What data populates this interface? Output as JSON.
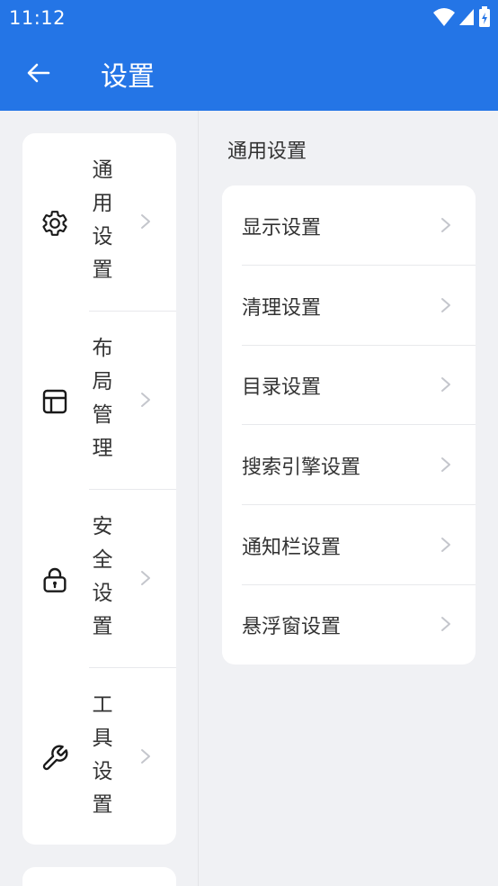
{
  "status_bar": {
    "time": "11:12",
    "icons": [
      "wifi-icon",
      "signal-icon",
      "battery-icon"
    ]
  },
  "app_bar": {
    "title": "设置",
    "back_icon": "arrow-left-icon"
  },
  "colors": {
    "primary": "#2475e6",
    "background": "#f0f1f4",
    "card": "#ffffff",
    "text": "#333333",
    "chevron": "#c4c6cc"
  },
  "sidebar": {
    "items": [
      {
        "label": "通用设置",
        "icon": "gear-icon"
      },
      {
        "label": "布局管理",
        "icon": "layout-icon"
      },
      {
        "label": "安全设置",
        "icon": "lock-icon"
      },
      {
        "label": "工具设置",
        "icon": "wrench-icon"
      }
    ]
  },
  "main": {
    "section_title": "通用设置",
    "items": [
      {
        "label": "显示设置"
      },
      {
        "label": "清理设置"
      },
      {
        "label": "目录设置"
      },
      {
        "label": "搜索引擎设置"
      },
      {
        "label": "通知栏设置"
      },
      {
        "label": "悬浮窗设置"
      }
    ]
  }
}
